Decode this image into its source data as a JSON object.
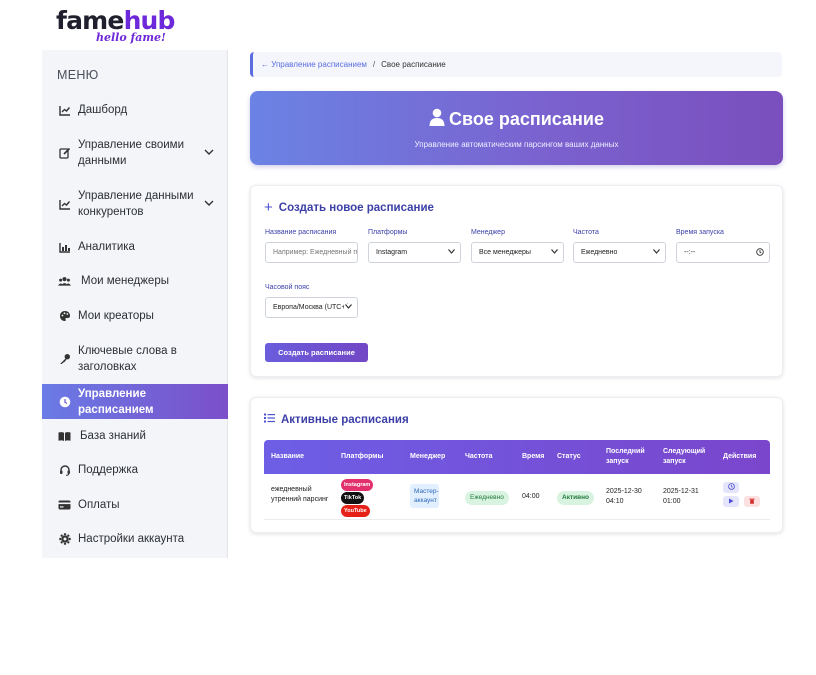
{
  "brand": {
    "name_part1": "fame",
    "name_part2": "hub",
    "tagline": "hello fame!"
  },
  "sidebar": {
    "title": "МЕНЮ",
    "items": [
      {
        "label": "Дашборд",
        "icon": "chart-line-icon"
      },
      {
        "label": "Управление своими данными",
        "icon": "edit-icon",
        "expandable": true
      },
      {
        "label": "Управление данными конкурентов",
        "icon": "chart-line-icon",
        "expandable": true
      },
      {
        "label": "Аналитика",
        "icon": "bar-chart-icon"
      },
      {
        "label": "Мои менеджеры",
        "icon": "users-icon"
      },
      {
        "label": "Мои креаторы",
        "icon": "palette-icon"
      },
      {
        "label": "Ключевые слова в заголовках",
        "icon": "key-icon"
      },
      {
        "label": "Управление расписанием",
        "icon": "clock-icon",
        "active": true
      },
      {
        "label": "База знаний",
        "icon": "book-icon"
      },
      {
        "label": "Поддержка",
        "icon": "headset-icon"
      },
      {
        "label": "Оплаты",
        "icon": "credit-card-icon"
      },
      {
        "label": "Настройки аккаунта",
        "icon": "gear-icon"
      }
    ]
  },
  "breadcrumb": {
    "back": "← Управление расписанием",
    "separator": "/",
    "current": "Свое расписание"
  },
  "hero": {
    "title": "Свое расписание",
    "subtitle": "Управление автоматическим парсингом ваших данных"
  },
  "create_form": {
    "title": "Создать новое расписание",
    "name_label": "Название расписания",
    "name_placeholder": "Например: Ежедневный п",
    "platforms_label": "Платформы",
    "platforms_value": "Instagram",
    "manager_label": "Менеджер",
    "manager_value": "Все менеджеры",
    "frequency_label": "Частота",
    "frequency_value": "Ежедневно",
    "time_label": "Время запуска",
    "time_value": "--:--",
    "timezone_label": "Часовой пояс",
    "timezone_value": "Европа/Москва (UTC+(",
    "submit_label": "Создать расписание"
  },
  "active": {
    "title": "Активные расписания",
    "columns": [
      "Название",
      "Платформы",
      "Менеджер",
      "Частота",
      "Время",
      "Статус",
      "Последний запуск",
      "Следующий запуск",
      "Действия"
    ],
    "rows": [
      {
        "name": "ежедневный утренний парсинг",
        "platforms": [
          "Instagram",
          "TikTok",
          "YouTube"
        ],
        "manager": "Мастер-аккаунт",
        "frequency": "Ежедневно",
        "time": "04:00",
        "status": "Активно",
        "last_run_date": "2025-12-30",
        "last_run_time": "04:10",
        "next_run_date": "2025-12-31",
        "next_run_time": "01:00"
      }
    ]
  },
  "colors": {
    "accent": "#6d28d9",
    "active_nav_start": "#6a7be6",
    "active_nav_end": "#7b4fc9",
    "instagram": "#e1306c",
    "tiktok": "#111111",
    "youtube": "#e62117",
    "status_green": "#d9f3e1"
  }
}
